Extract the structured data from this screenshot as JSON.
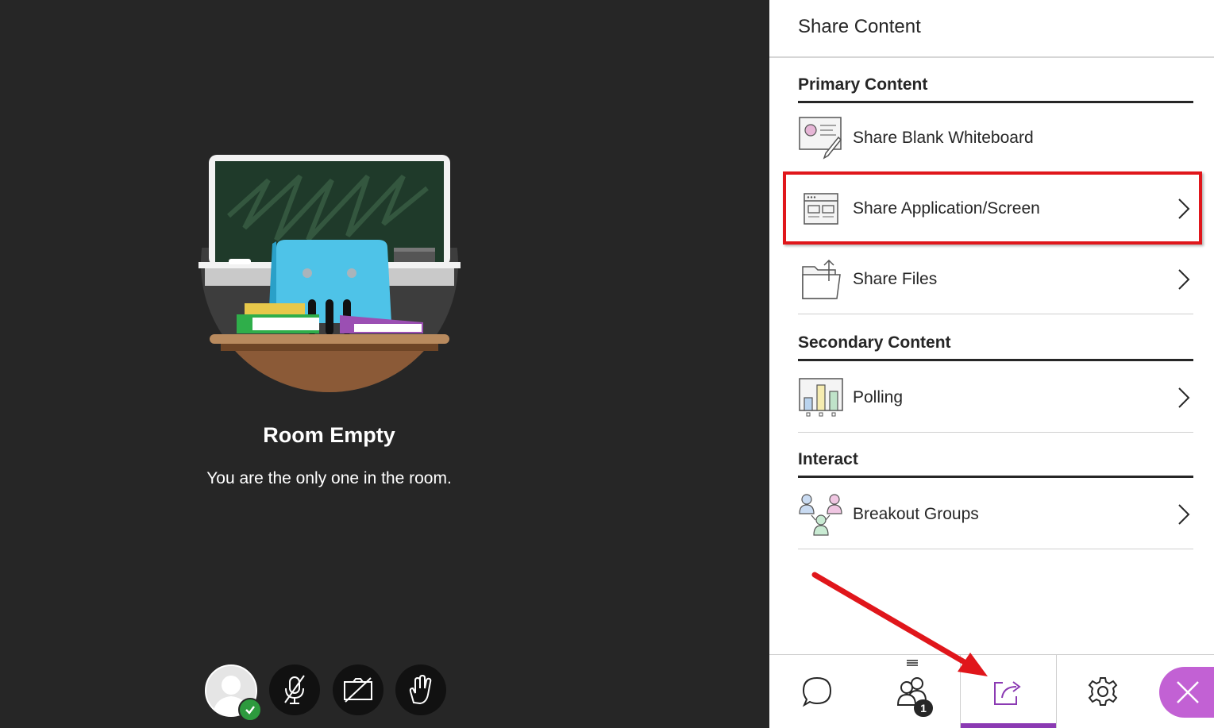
{
  "stage": {
    "title": "Room Empty",
    "subtitle": "You are the only one in the room."
  },
  "controls": [
    {
      "name": "my-status-avatar",
      "icon": "user-avatar-icon",
      "status": "check-icon"
    },
    {
      "name": "microphone-button",
      "icon": "microphone-muted-icon"
    },
    {
      "name": "camera-button",
      "icon": "camera-off-icon"
    },
    {
      "name": "raise-hand-button",
      "icon": "hand-icon"
    }
  ],
  "panel": {
    "title": "Share Content",
    "sections": {
      "primary": "Primary Content",
      "secondary": "Secondary Content",
      "interact": "Interact"
    },
    "items": {
      "whiteboard": {
        "label": "Share Blank Whiteboard",
        "icon": "whiteboard-icon"
      },
      "screen": {
        "label": "Share Application/Screen",
        "icon": "app-window-icon"
      },
      "files": {
        "label": "Share Files",
        "icon": "folder-upload-icon"
      },
      "polling": {
        "label": "Polling",
        "icon": "bar-chart-icon"
      },
      "breakout": {
        "label": "Breakout Groups",
        "icon": "groups-icon"
      }
    }
  },
  "bottombar": {
    "tabs": [
      "chat-icon",
      "attendees-icon",
      "share-content-icon",
      "settings-icon"
    ],
    "attendee_count": "1",
    "active": "share-content",
    "close_icon": "close-icon"
  },
  "colors": {
    "stage_bg": "#262626",
    "accent": "#8b3ab3",
    "close_bg": "#c261d4",
    "highlight": "#e0161b"
  }
}
